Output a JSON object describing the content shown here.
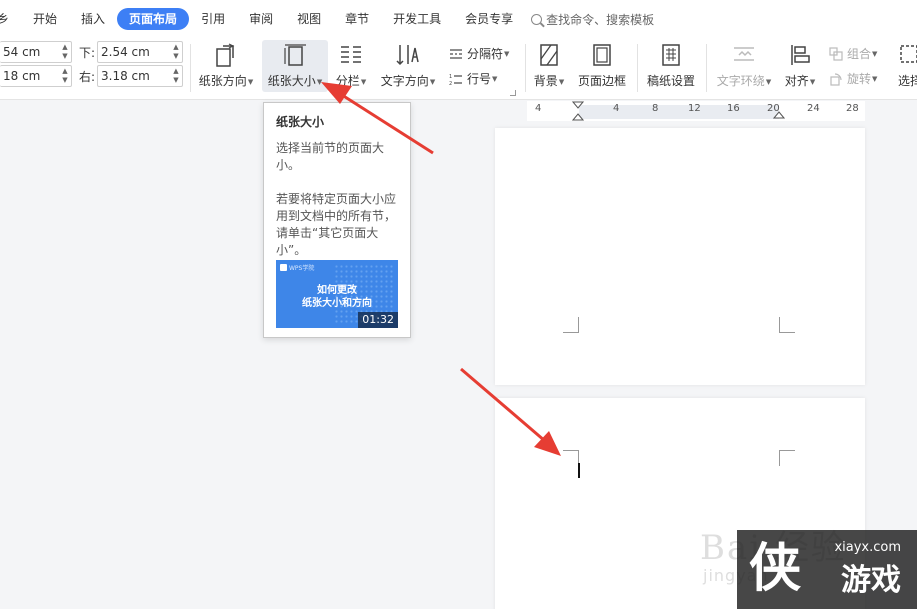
{
  "menubar": {
    "items": [
      {
        "label": "乡",
        "active": false
      },
      {
        "label": "开始",
        "active": false
      },
      {
        "label": "插入",
        "active": false
      },
      {
        "label": "页面布局",
        "active": true
      },
      {
        "label": "引用",
        "active": false
      },
      {
        "label": "审阅",
        "active": false
      },
      {
        "label": "视图",
        "active": false
      },
      {
        "label": "章节",
        "active": false
      },
      {
        "label": "开发工具",
        "active": false
      },
      {
        "label": "会员专享",
        "active": false
      }
    ],
    "search_label": "查找命令、搜索模板"
  },
  "margins": {
    "top_value": "54 cm",
    "bottom_label": "下:",
    "bottom_value": "2.54 cm",
    "left_value": "18 cm",
    "right_label": "右:",
    "right_value": "3.18 cm"
  },
  "ribbon": {
    "orientation": "纸张方向",
    "paper_size": "纸张大小",
    "columns": "分栏",
    "text_direction": "文字方向",
    "separator": "分隔符",
    "line_number": "行号",
    "background": "背景",
    "page_border": "页面边框",
    "manuscript": "稿纸设置",
    "text_wrap": "文字环绕",
    "align": "对齐",
    "group": "组合",
    "rotate": "旋转",
    "select": "选择"
  },
  "ruler": {
    "ticks": [
      "4",
      "4",
      "8",
      "12",
      "16",
      "20",
      "24",
      "28"
    ]
  },
  "tooltip": {
    "title": "纸张大小",
    "desc1": "选择当前节的页面大小。",
    "desc2": "若要将特定页面大小应用到文档中的所有节，请单击“其它页面大小”。",
    "video_brand": "WPS学院",
    "video_title_1": "如何更改",
    "video_title_2": "纸张大小和方向",
    "video_duration": "01:32"
  },
  "watermark": {
    "faint_text": "Bai 经验",
    "faint_sub": "jingyan",
    "site": "xiayx.com",
    "big_char": "侠",
    "game_text": "游戏"
  },
  "colors": {
    "accent": "#3d7ff5",
    "arrow": "#e63d33"
  }
}
